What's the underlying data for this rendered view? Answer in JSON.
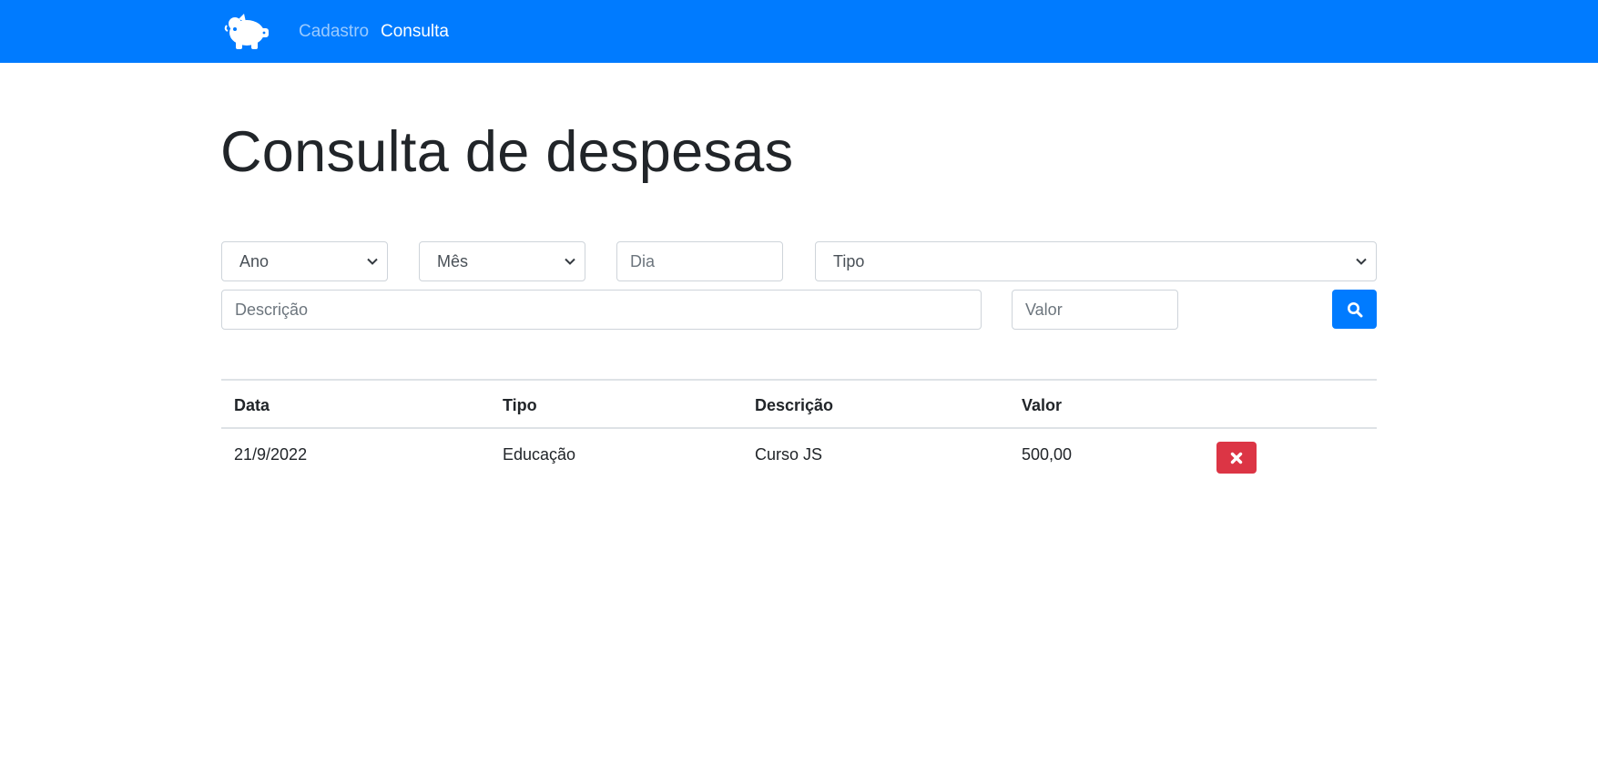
{
  "navbar": {
    "logo_icon": "piggy-bank-icon",
    "links": [
      {
        "label": "Cadastro",
        "active": false
      },
      {
        "label": "Consulta",
        "active": true
      }
    ],
    "background_color": "#007bff"
  },
  "page": {
    "title": "Consulta de despesas"
  },
  "filters": {
    "ano": {
      "selected": "Ano"
    },
    "mes": {
      "selected": "Mês"
    },
    "dia": {
      "value": "",
      "placeholder": "Dia"
    },
    "tipo": {
      "selected": "Tipo"
    },
    "descricao": {
      "value": "",
      "placeholder": "Descrição"
    },
    "valor": {
      "value": "",
      "placeholder": "Valor"
    },
    "search_icon": "search-icon"
  },
  "table": {
    "headers": [
      "Data",
      "Tipo",
      "Descrição",
      "Valor"
    ],
    "rows": [
      {
        "data": "21/9/2022",
        "tipo": "Educação",
        "descricao": "Curso JS",
        "valor": "500,00",
        "action_icon": "close-icon"
      }
    ]
  },
  "colors": {
    "primary": "#007bff",
    "danger": "#dc3545"
  }
}
